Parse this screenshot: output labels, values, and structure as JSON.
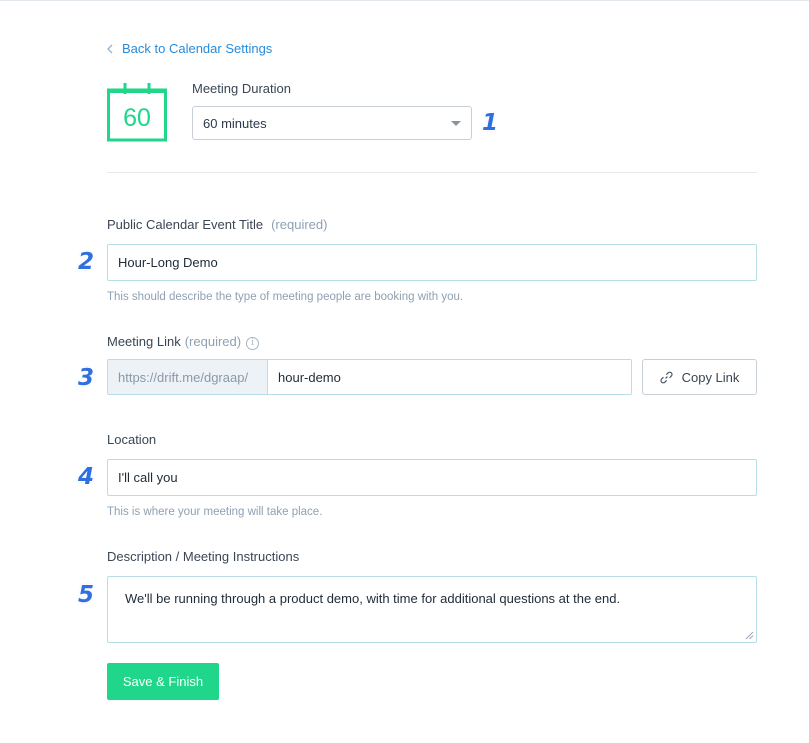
{
  "nav": {
    "back_label": "Back to Calendar Settings"
  },
  "duration": {
    "icon_number": "60",
    "label": "Meeting Duration",
    "selected": "60 minutes",
    "badge": "1"
  },
  "title_field": {
    "label": "Public Calendar Event Title",
    "required": "(required)",
    "value": "Hour-Long Demo",
    "help": "This should describe the type of meeting people are booking with you.",
    "badge": "2"
  },
  "link_field": {
    "label": "Meeting Link",
    "required": "(required)",
    "prefix": "https://drift.me/dgraap/",
    "value": "hour-demo",
    "copy_label": "Copy Link",
    "badge": "3"
  },
  "location_field": {
    "label": "Location",
    "value": "I'll call you",
    "help": "This is where your meeting will take place.",
    "badge": "4"
  },
  "description_field": {
    "label": "Description / Meeting Instructions",
    "value": "We'll be running through a product demo, with time for additional questions at the end.",
    "badge": "5"
  },
  "actions": {
    "save_label": "Save & Finish"
  },
  "colors": {
    "accent_green": "#1fd68a",
    "link_blue": "#2a8bd8",
    "badge_blue": "#2f6fe0",
    "input_border": "#b7dde7"
  }
}
